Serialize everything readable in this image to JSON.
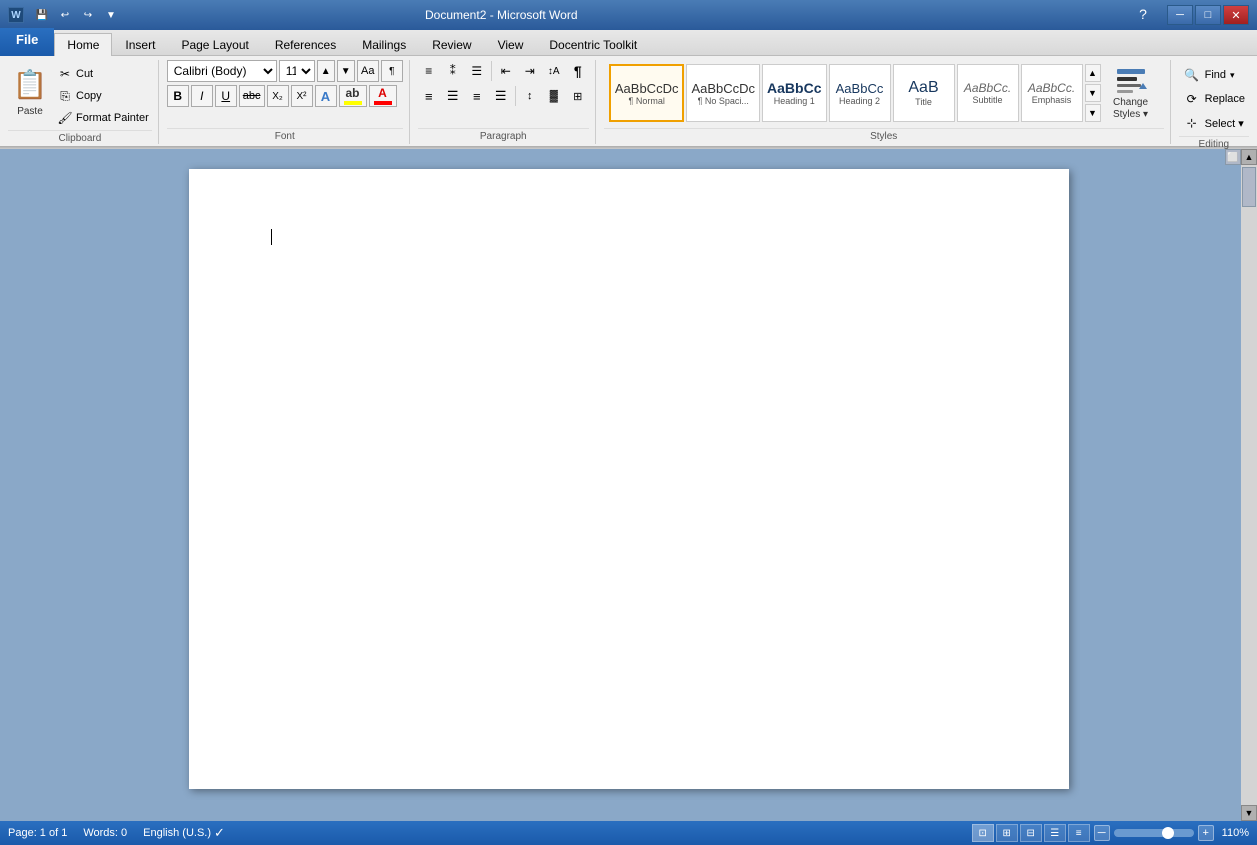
{
  "titlebar": {
    "title": "Document2 - Microsoft Word",
    "min_btn": "─",
    "max_btn": "□",
    "close_btn": "✕",
    "app_icon": "W"
  },
  "tabs": {
    "file": "File",
    "home": "Home",
    "insert": "Insert",
    "page_layout": "Page Layout",
    "references": "References",
    "mailings": "Mailings",
    "review": "Review",
    "view": "View",
    "docentric": "Docentric Toolkit"
  },
  "clipboard": {
    "group_label": "Clipboard",
    "paste_label": "Paste",
    "cut_label": "Cut",
    "copy_label": "Copy",
    "format_painter_label": "Format Painter"
  },
  "font": {
    "group_label": "Font",
    "font_name": "Calibri (Body)",
    "font_size": "11",
    "bold_label": "B",
    "italic_label": "I",
    "underline_label": "U",
    "strikethrough_label": "abc",
    "subscript_label": "X₂",
    "superscript_label": "X²",
    "text_highlight_label": "A",
    "font_color_label": "A"
  },
  "paragraph": {
    "group_label": "Paragraph"
  },
  "styles": {
    "group_label": "Styles",
    "items": [
      {
        "label": "AaBbCcDc",
        "sublabel": "¶ Normal",
        "selected": true
      },
      {
        "label": "AaBbCcDc",
        "sublabel": "¶ No Spaci..."
      },
      {
        "label": "AaBbCc",
        "sublabel": "Heading 1"
      },
      {
        "label": "AaBbCc",
        "sublabel": "Heading 2"
      },
      {
        "label": "AaB",
        "sublabel": "Title"
      },
      {
        "label": "AaBbCc.",
        "sublabel": "Subtitle"
      }
    ],
    "change_styles_label": "Change\nStyles",
    "more_label": "▼"
  },
  "editing": {
    "group_label": "Editing",
    "find_label": "Find",
    "replace_label": "Replace",
    "select_label": "Select ▾"
  },
  "statusbar": {
    "page_info": "Page: 1 of 1",
    "words_info": "Words: 0",
    "language": "English (U.S.)",
    "zoom_pct": "110%",
    "zoom_minus": "─",
    "zoom_plus": "+"
  }
}
